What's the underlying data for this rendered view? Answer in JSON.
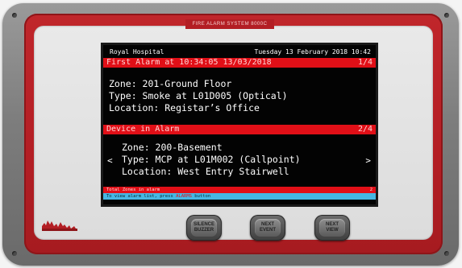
{
  "panel": {
    "title": "FIRE ALARM SYSTEM 8000C"
  },
  "display": {
    "site": "Royal Hospital",
    "datetime": "Tuesday 13 February 2018 10:42",
    "first_alarm": {
      "heading": "First Alarm at 10:34:05 13/03/2018",
      "counter": "1/4",
      "zone": "Zone: 201-Ground Floor",
      "type": "Type: Smoke at L01D005 (Optical)",
      "location": "Location: Registar’s Office"
    },
    "device_alarm": {
      "heading": "Device in Alarm",
      "counter": "2/4",
      "zone": "Zone: 200-Basement",
      "type": "Type: MCP at L01M002 (Callpoint)",
      "location": "Location: West Entry Stairwell",
      "prev_symbol": "<",
      "next_symbol": ">"
    },
    "total_zones": {
      "label": "Total Zones in alarm",
      "count": "2"
    },
    "hint": {
      "prefix": "To view alarm list, press ",
      "keyword": "ALARMS",
      "suffix": " button"
    }
  },
  "buttons": [
    {
      "label": "SILENCE\nBUZZER"
    },
    {
      "label": "NEXT\nEVENT"
    },
    {
      "label": "NEXT\nVIEW"
    }
  ],
  "colors": {
    "front_red": "#b31e24",
    "lcd_bar_red": "#e10f17",
    "lcd_hint_blue": "#46b7e3"
  }
}
